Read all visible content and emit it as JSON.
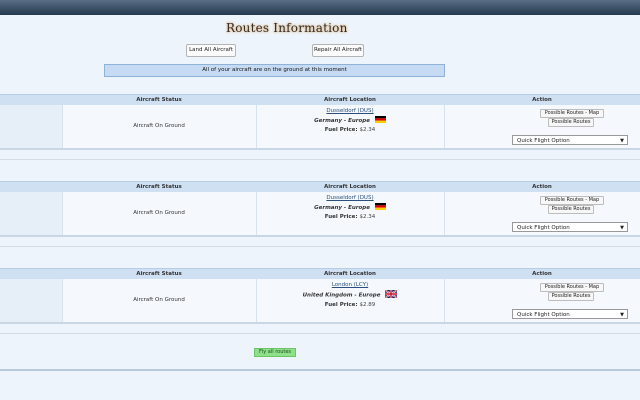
{
  "page": {
    "title": "Routes Information"
  },
  "toolbar": {
    "land_all": "Land All Aircraft",
    "repair_all": "Repair All Aircraft"
  },
  "notice": "All of your aircraft are on the ground at this moment",
  "columns": {
    "status": "Aircraft Status",
    "location": "Aircraft Location",
    "action": "Action"
  },
  "aircraft": [
    {
      "status": "Aircraft On Ground",
      "location": "Dusseldorf (DUS)",
      "country": "Germany - Europe",
      "flag": "germany-flag",
      "fuel_label": "Fuel Price:",
      "fuel_price": "$2.34",
      "routes_map": "Possible Routes - Map",
      "routes": "Possible Routes",
      "quick_flight": "Quick Flight Option"
    },
    {
      "status": "Aircraft On Ground",
      "location": "Dusseldorf (DUS)",
      "country": "Germany - Europe",
      "flag": "germany-flag",
      "fuel_label": "Fuel Price:",
      "fuel_price": "$2.34",
      "routes_map": "Possible Routes - Map",
      "routes": "Possible Routes",
      "quick_flight": "Quick Flight Option"
    },
    {
      "status": "Aircraft On Ground",
      "location": "London (LCY)",
      "country": "United Kingdom - Europe",
      "flag": "uk-flag",
      "fuel_label": "Fuel Price:",
      "fuel_price": "$2.89",
      "routes_map": "Possible Routes - Map",
      "routes": "Possible Routes",
      "quick_flight": "Quick Flight Option"
    }
  ],
  "fly_all": "Fly all routes",
  "colors": {
    "header_bg": "#cfe0f3",
    "notice_bg": "#c6dbf3",
    "fly_btn": "#8fe08a",
    "topbar": "#2b3f55"
  }
}
